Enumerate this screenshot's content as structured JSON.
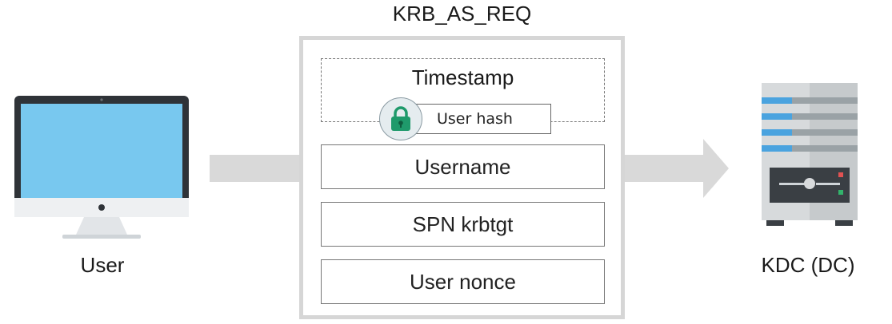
{
  "title": "KRB_AS_REQ",
  "left_label": "User",
  "right_label": "KDC (DC)",
  "message": {
    "timestamp": "Timestamp",
    "user_hash": "User hash",
    "fields": [
      "Username",
      "SPN krbtgt",
      "User nonce"
    ]
  },
  "icons": {
    "left": "desktop-computer-icon",
    "right": "server-tower-icon",
    "lock": "padlock-icon"
  },
  "colors": {
    "screen": "#78c8ef",
    "arrow": "#d9d9d9",
    "lock_green": "#1f9a6b",
    "server_stripe": "#4aa3df"
  }
}
